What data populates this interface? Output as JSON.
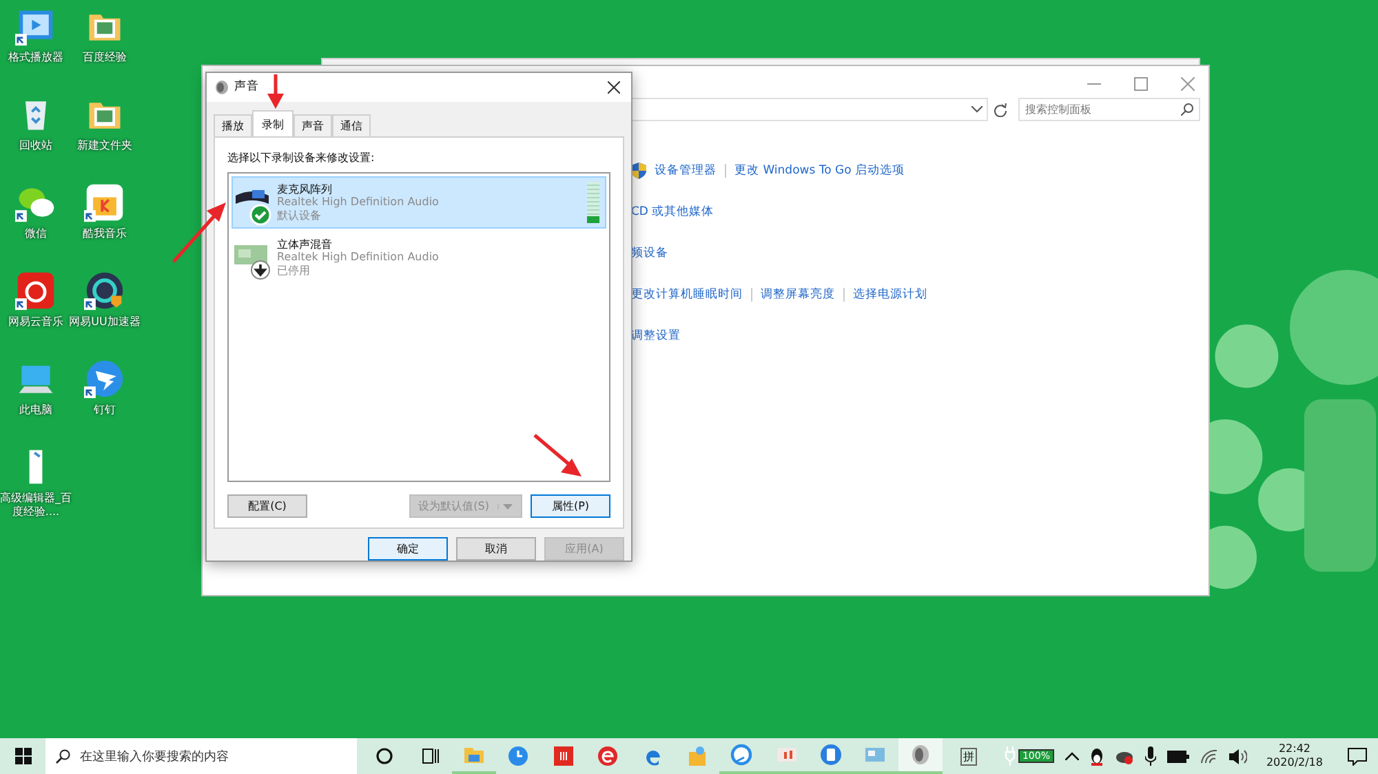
{
  "desktop_icons": [
    {
      "label": "格式播放器",
      "kind": "video",
      "shortcut": true
    },
    {
      "label": "百度经验",
      "kind": "folder",
      "shortcut": false
    },
    {
      "label": "回收站",
      "kind": "recycle",
      "shortcut": false
    },
    {
      "label": "新建文件夹",
      "kind": "folder",
      "shortcut": false
    },
    {
      "label": "微信",
      "kind": "chat",
      "shortcut": true
    },
    {
      "label": "酷我音乐",
      "kind": "music",
      "shortcut": true
    },
    {
      "label": "网易云音乐",
      "kind": "netease",
      "shortcut": true
    },
    {
      "label": "网易UU加速器",
      "kind": "uu",
      "shortcut": true
    },
    {
      "label": "此电脑",
      "kind": "pc",
      "shortcut": false
    },
    {
      "label": "钉钉",
      "kind": "wing",
      "shortcut": true
    },
    {
      "label": "高级编辑器_百度经验....",
      "kind": "file",
      "shortcut": false
    }
  ],
  "control_panel": {
    "search": {
      "placeholder": "搜索控制面板"
    },
    "link_rows": [
      {
        "shield": true,
        "links": [
          "设备管理器",
          "更改 Windows To Go 启动选项"
        ]
      },
      {
        "shield": false,
        "links": [
          "CD 或其他媒体"
        ]
      },
      {
        "shield": false,
        "links": [
          "频设备"
        ]
      },
      {
        "shield": false,
        "links": [
          "更改计算机睡眠时间",
          "调整屏幕亮度",
          "选择电源计划"
        ]
      },
      {
        "shield": false,
        "links": [
          "调整设置"
        ]
      }
    ]
  },
  "dialog": {
    "title": "声音",
    "tabs": [
      {
        "label": "播放",
        "selected": false
      },
      {
        "label": "录制",
        "selected": true
      },
      {
        "label": "声音",
        "selected": false
      },
      {
        "label": "通信",
        "selected": false
      }
    ],
    "instruction": "选择以下录制设备来修改设置:",
    "devices": [
      {
        "name": "麦克风阵列",
        "driver": "Realtek High Definition Audio",
        "status": "默认设备",
        "kind": "microphone",
        "default": true,
        "disabled": false,
        "selected": true,
        "level": 0.15
      },
      {
        "name": "立体声混音",
        "driver": "Realtek High Definition Audio",
        "status": "已停用",
        "kind": "board",
        "default": false,
        "disabled": true,
        "selected": false
      }
    ],
    "panel_buttons": [
      {
        "label": "配置(C)",
        "kind": "plain",
        "disabled": false,
        "focused": false
      },
      {
        "label": "设为默认值(S)",
        "kind": "split",
        "disabled": true,
        "focused": false
      },
      {
        "label": "属性(P)",
        "kind": "plain",
        "disabled": false,
        "focused": true
      }
    ],
    "footer_buttons": [
      {
        "label": "确定",
        "disabled": false,
        "focused": true
      },
      {
        "label": "取消",
        "disabled": false,
        "focused": false
      },
      {
        "label": "应用(A)",
        "disabled": true,
        "focused": false
      }
    ]
  },
  "taskbar": {
    "search": {
      "placeholder": "在这里输入你要搜索的内容"
    },
    "apps": [
      {
        "kind": "circle",
        "running": false,
        "selected": false
      },
      {
        "kind": "taskview",
        "running": false,
        "selected": false
      },
      {
        "kind": "explorer",
        "running": true,
        "selected": false
      },
      {
        "kind": "clock",
        "running": false,
        "selected": false
      },
      {
        "kind": "redsquare",
        "running": false,
        "selected": false
      },
      {
        "kind": "rede",
        "running": false,
        "selected": false
      },
      {
        "kind": "edge",
        "running": false,
        "selected": false
      },
      {
        "kind": "box",
        "running": false,
        "selected": false
      },
      {
        "kind": "browser",
        "running": true,
        "selected": false
      },
      {
        "kind": "slides",
        "running": true,
        "selected": false
      },
      {
        "kind": "phone",
        "running": true,
        "selected": false
      },
      {
        "kind": "photo",
        "running": true,
        "selected": false
      },
      {
        "kind": "speaker",
        "running": true,
        "selected": true
      }
    ],
    "ime": "拼",
    "battery": "100%",
    "time": "22:42",
    "date": "2020/2/18"
  }
}
